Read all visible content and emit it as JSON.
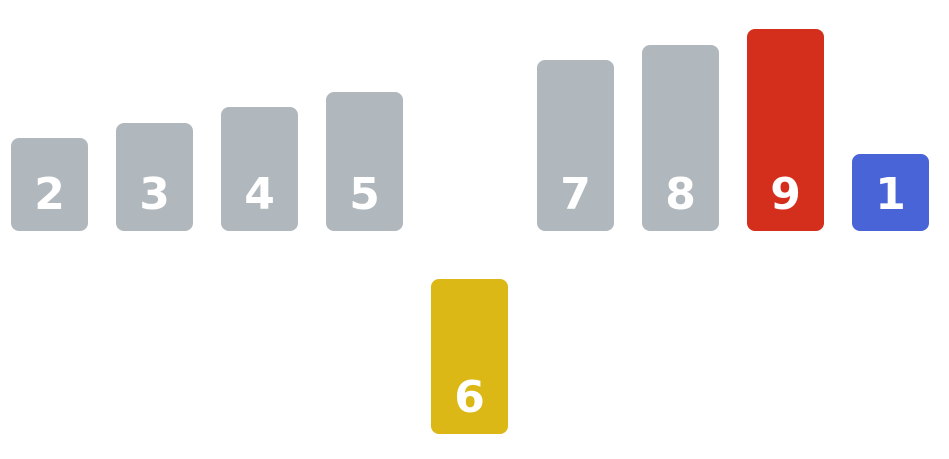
{
  "colors": {
    "default": "#b1b8bd",
    "lifted": "#dbb816",
    "max": "#d42f1d",
    "inserted": "#4964d6",
    "background": "#ffffff"
  },
  "bars": [
    {
      "label": "2",
      "value": 2,
      "state": "default"
    },
    {
      "label": "3",
      "value": 3,
      "state": "default"
    },
    {
      "label": "4",
      "value": 4,
      "state": "default"
    },
    {
      "label": "5",
      "value": 5,
      "state": "default"
    },
    {
      "label": "6",
      "value": 6,
      "state": "lifted"
    },
    {
      "label": "7",
      "value": 7,
      "state": "default"
    },
    {
      "label": "8",
      "value": 8,
      "state": "default"
    },
    {
      "label": "9",
      "value": 9,
      "state": "max"
    },
    {
      "label": "1",
      "value": 1,
      "state": "inserted"
    }
  ]
}
